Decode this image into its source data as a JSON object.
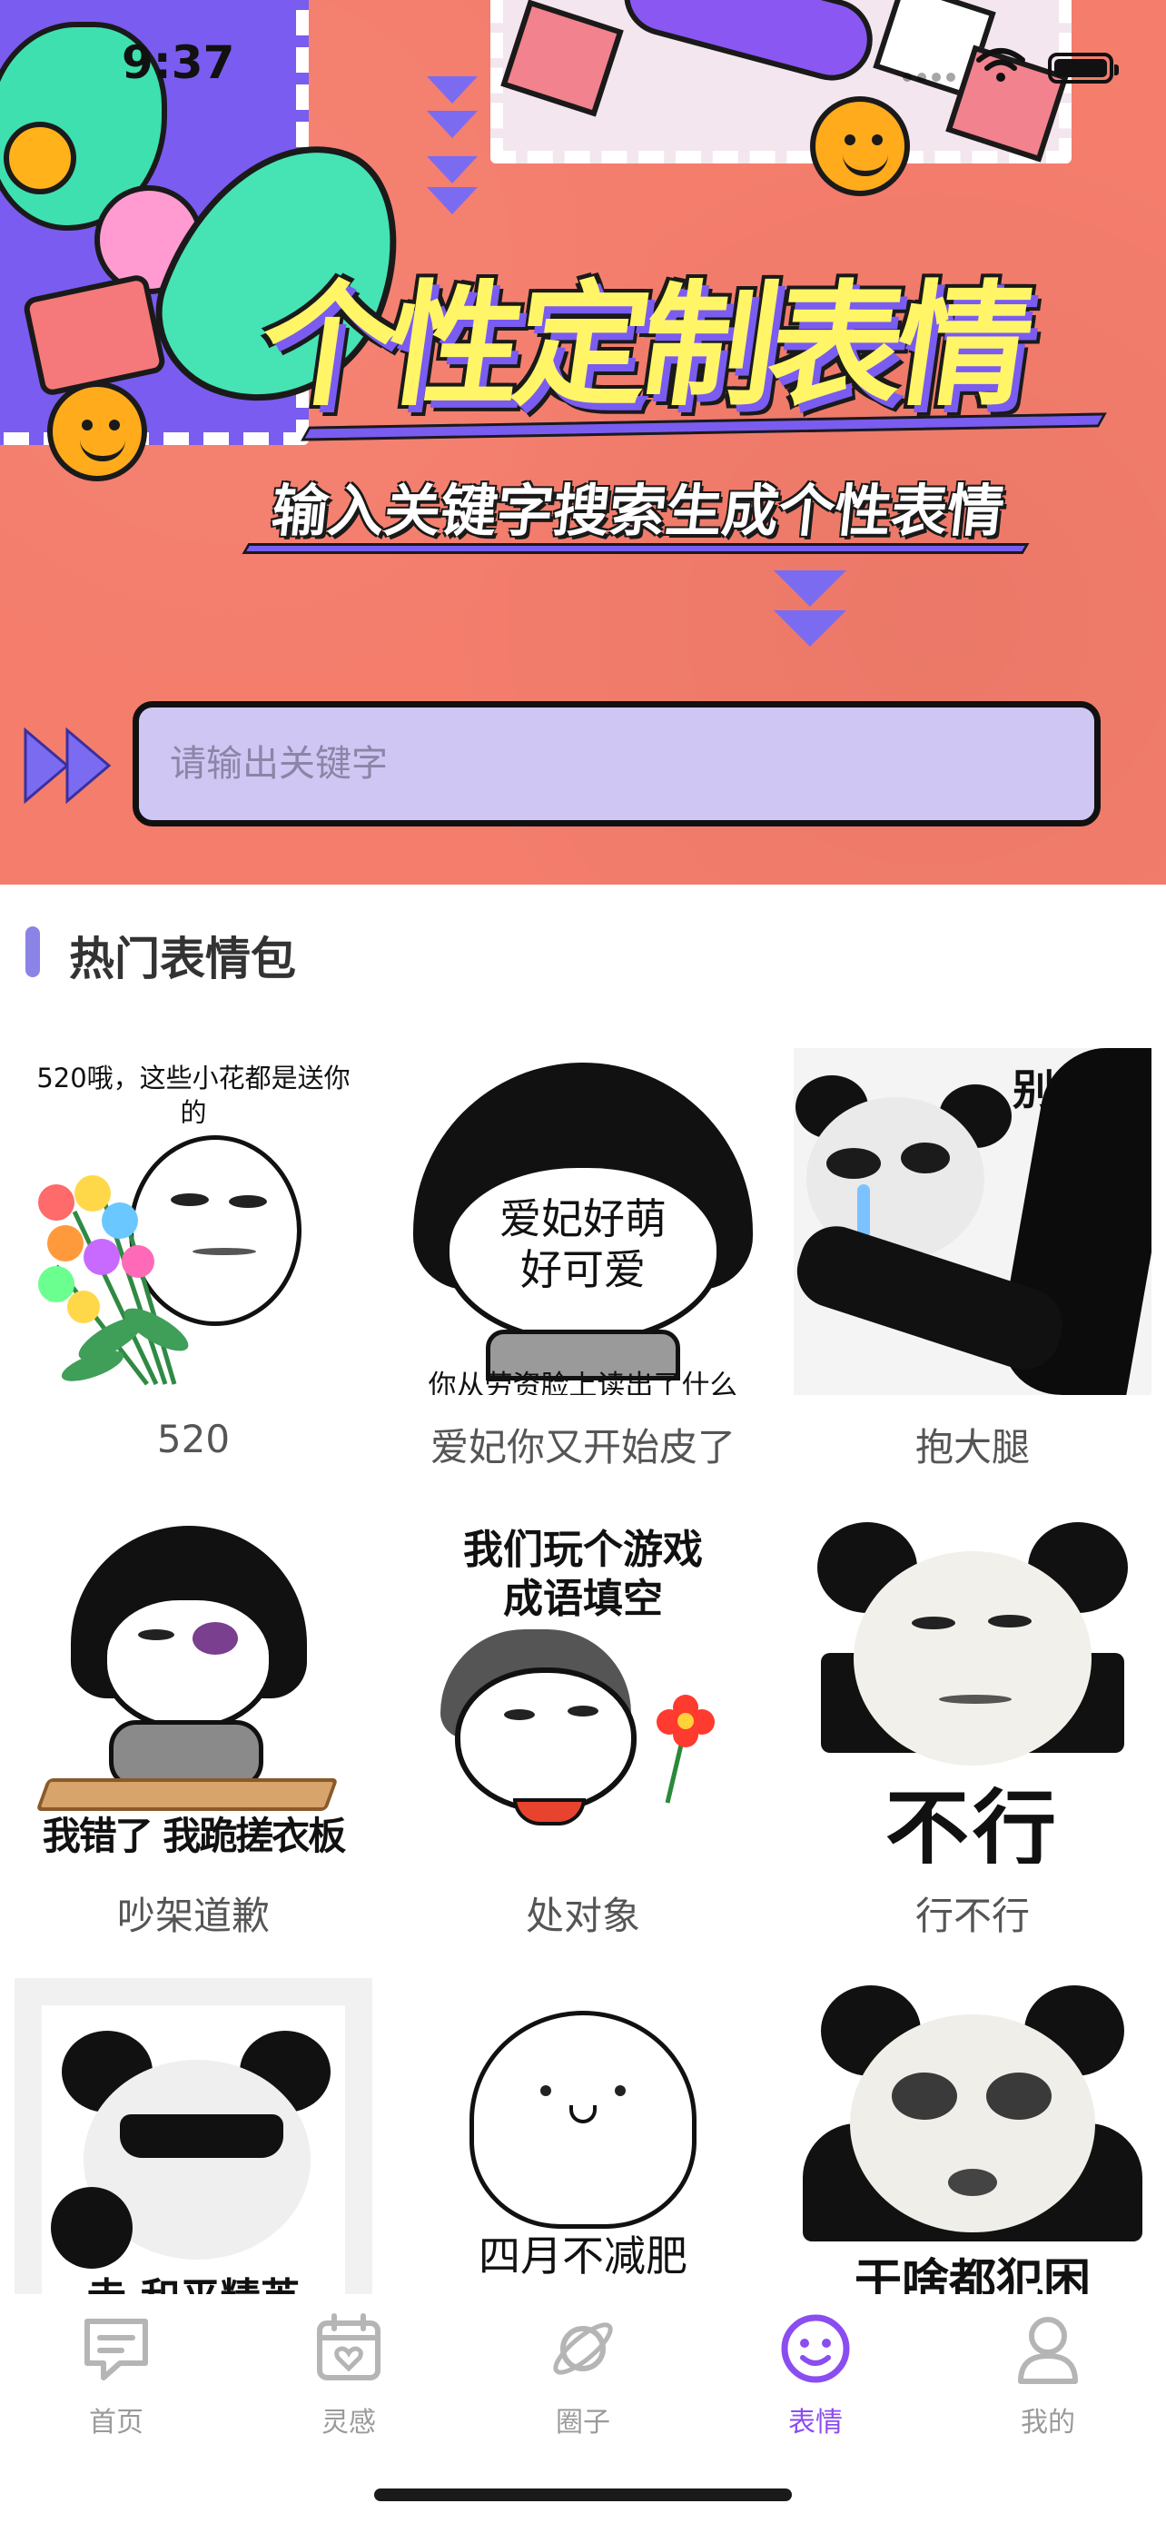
{
  "status_bar": {
    "time": "9:37"
  },
  "hero": {
    "title": "个性定制表情",
    "subtitle": "输入关键字搜索生成个性表情",
    "search_placeholder": "请输出关键字"
  },
  "section": {
    "title": "热门表情包"
  },
  "memes": [
    {
      "caption": "520",
      "top_text": "520哦，这些小花都是送你的",
      "bottom_text": ""
    },
    {
      "caption": "爱妃你又开始皮了",
      "center_text": "爱妃好萌 好可爱",
      "bottom_text": "你从劳资脸上读出了什么"
    },
    {
      "caption": "抱大腿",
      "top_text": "别走",
      "bottom_text": ""
    },
    {
      "caption": "吵架道歉",
      "top_text": "",
      "bottom_text": "我错了 我跪搓衣板"
    },
    {
      "caption": "处对象",
      "top_text": "我们玩个游戏 成语填空",
      "bottom_text": ""
    },
    {
      "caption": "行不行",
      "top_text": "",
      "bottom_text": "不行"
    },
    {
      "caption": "",
      "top_text": "",
      "bottom_text": "走 和平精英"
    },
    {
      "caption": "",
      "top_text": "",
      "bottom_text": "四月不减肥"
    },
    {
      "caption": "",
      "top_text": "",
      "bottom_text": "干啥都犯困"
    }
  ],
  "tabbar": {
    "items": [
      {
        "label": "首页",
        "icon": "chat-bubble-icon",
        "active": false
      },
      {
        "label": "灵感",
        "icon": "inspiration-card-icon",
        "active": false
      },
      {
        "label": "圈子",
        "icon": "planet-icon",
        "active": false
      },
      {
        "label": "表情",
        "icon": "smiley-face-icon",
        "active": true
      },
      {
        "label": "我的",
        "icon": "user-icon",
        "active": false
      }
    ]
  },
  "colors": {
    "hero_bg": "#f47d6c",
    "accent": "#8b4df0",
    "search_bg": "#cfc6f3",
    "section_bar": "#8c83e6",
    "tab_inactive": "#9a9a9a"
  }
}
